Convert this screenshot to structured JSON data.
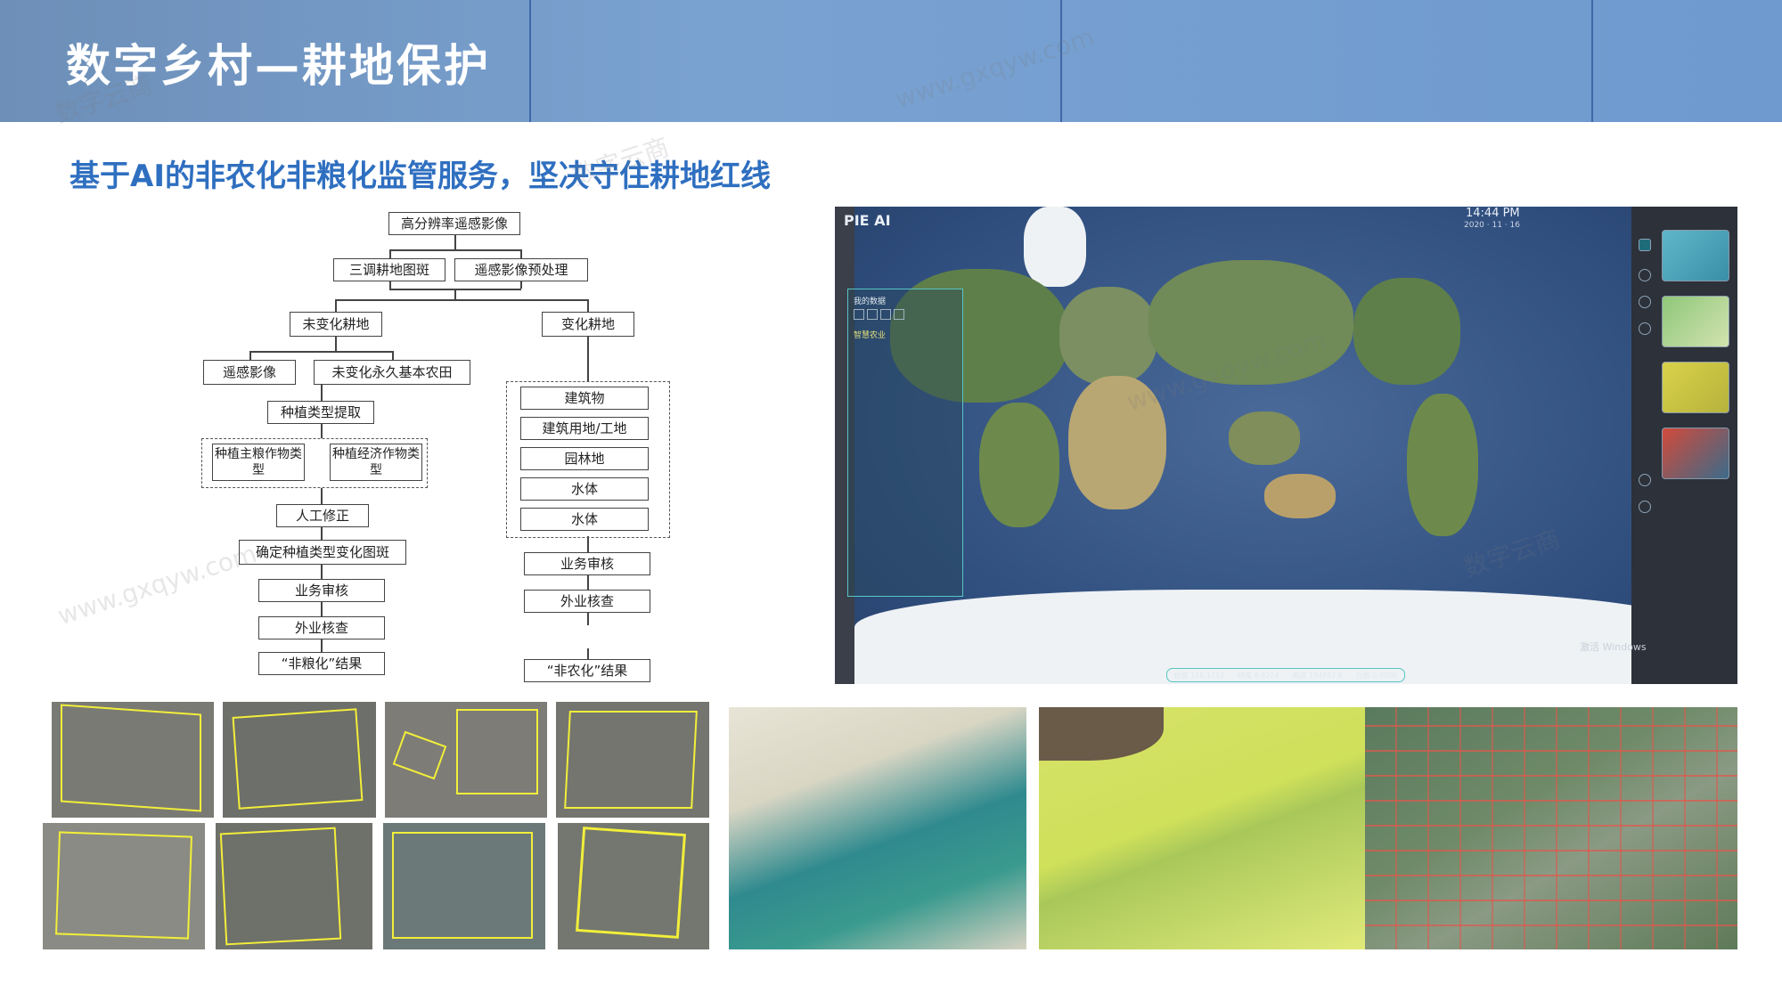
{
  "header": {
    "title": "数字乡村—耕地保护"
  },
  "subtitle": "基于AI的非农化非粮化监管服务，坚决守住耕地红线",
  "flowchart": {
    "top": "高分辨率遥感影像",
    "survey_map": "三调耕地图斑",
    "preprocess": "遥感影像预处理",
    "unchanged": "未变化耕地",
    "changed": "变化耕地",
    "rs_image": "遥感影像",
    "basic_farmland": "未变化永久基本农田",
    "crop_extract": "种植类型提取",
    "grain_type": "种植主粮作物类型",
    "cash_type": "种植经济作物类型",
    "manual": "人工修正",
    "confirm": "确定种植类型变化图斑",
    "review_left": "业务审核",
    "field_left": "外业核查",
    "result_left": "“非粮化”结果",
    "building": "建筑物",
    "construction": "建筑用地/工地",
    "garden": "园林地",
    "water1": "水体",
    "water2": "水体",
    "review_right": "业务审核",
    "field_right": "外业核查",
    "result_right": "“非农化”结果"
  },
  "app": {
    "logo": "PIE AI",
    "time": "14:44 PM",
    "date": "2020 · 11 · 16",
    "panel_title": "我的数据",
    "panel_item": "智慧农业",
    "coords": [
      "经度 116.1752",
      "纬度 9.6224",
      "高度 104857.6",
      "比例 0.0000"
    ],
    "windows_mark": "激活 Windows"
  },
  "watermark": {
    "cn": "数字云商",
    "url": "www.gxqyw.com"
  },
  "colors": {
    "banner": "#6f97c9",
    "subtitle": "#2f6fc0",
    "polygon": "#f2ee3a",
    "parcel_red": "#e2574c"
  }
}
